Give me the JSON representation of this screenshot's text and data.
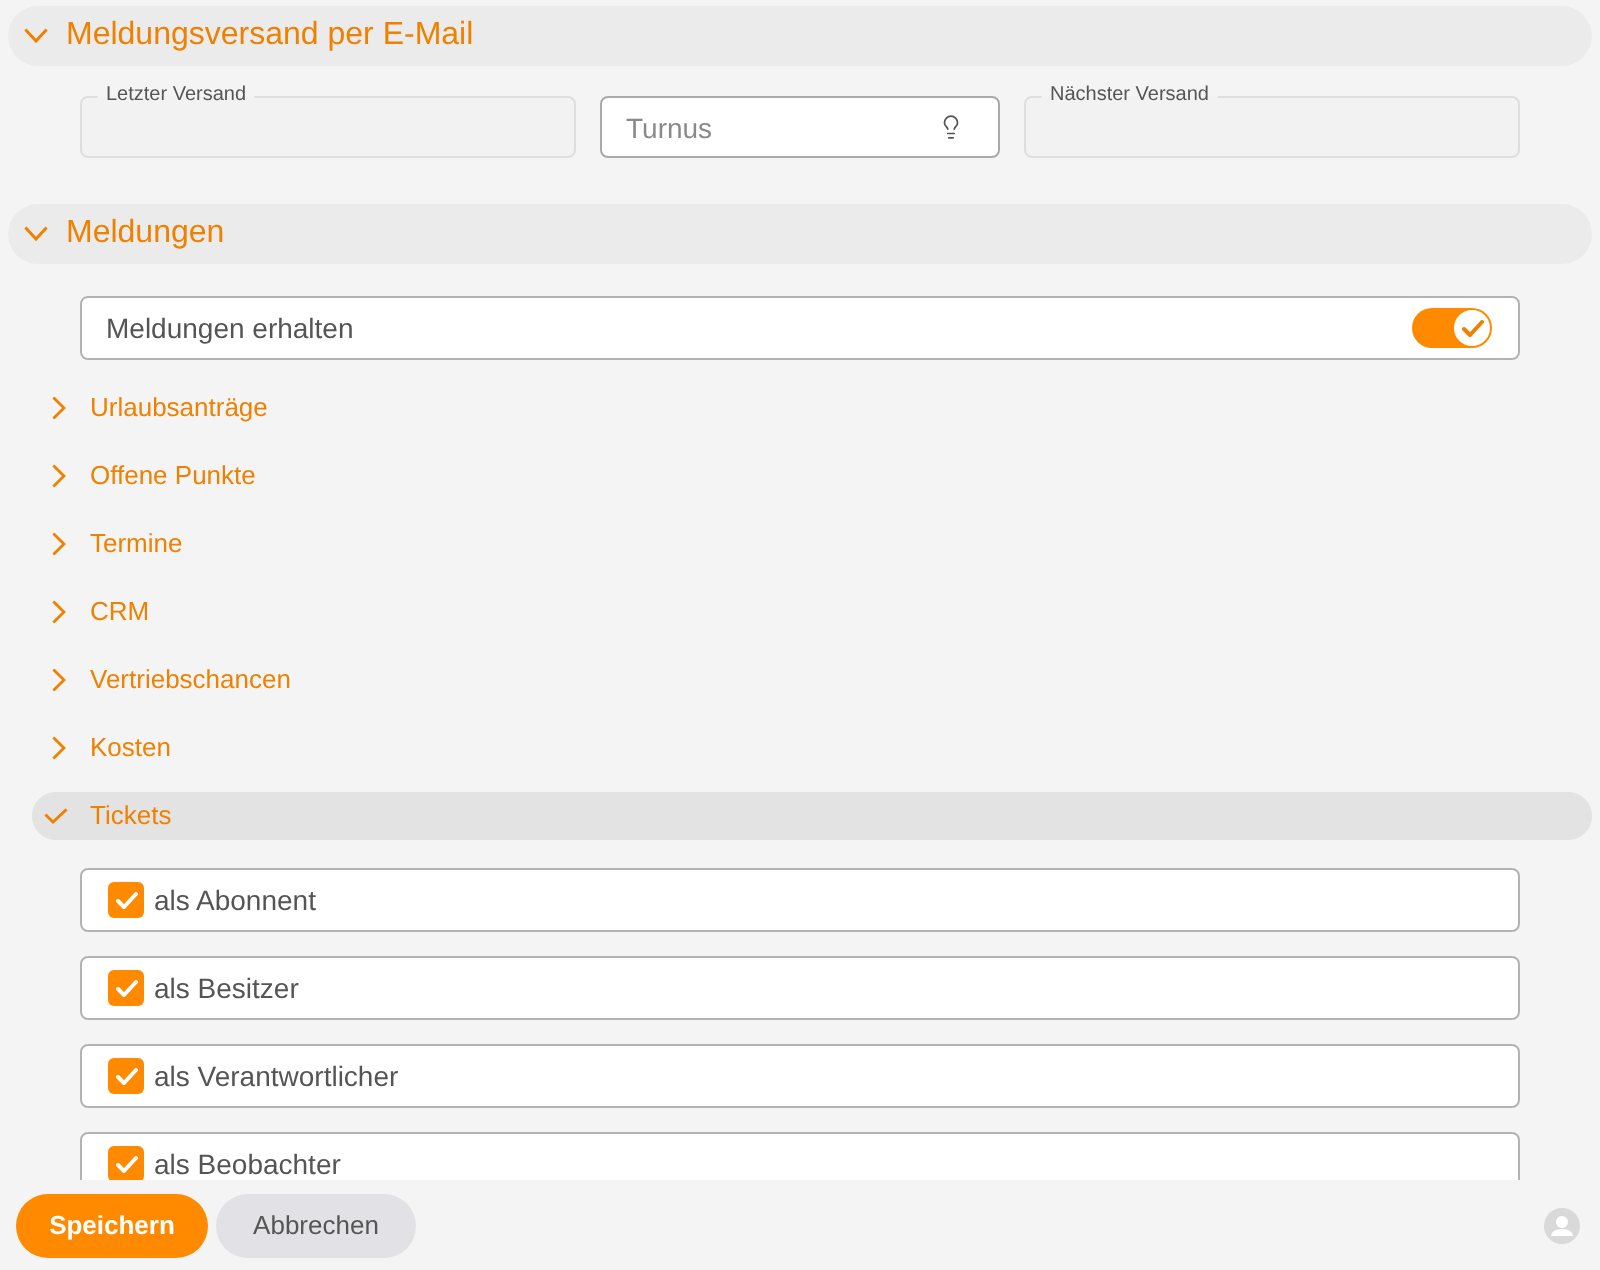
{
  "sections": [
    {
      "kind": "delivery",
      "title": "Meldungsversand per E-Mail",
      "expanded": true,
      "fields": [
        {
          "kind": "readonly",
          "label": "Letzter Versand"
        },
        {
          "kind": "input",
          "placeholder": "Turnus"
        },
        {
          "kind": "readonly",
          "label": "Nächster Versand"
        }
      ]
    },
    {
      "kind": "notifications",
      "title": "Meldungen",
      "expanded": true,
      "toggle": {
        "label": "Meldungen erhalten",
        "on": true
      },
      "categories": [
        {
          "label": "Urlaubsanträge",
          "expanded": false
        },
        {
          "label": "Offene Punkte",
          "expanded": false
        },
        {
          "label": "Termine",
          "expanded": false
        },
        {
          "label": "CRM",
          "expanded": false
        },
        {
          "label": "Vertriebschancen",
          "expanded": false
        },
        {
          "label": "Kosten",
          "expanded": false
        },
        {
          "label": "Tickets",
          "expanded": true,
          "options": [
            {
              "label": "als Abonnent",
              "checked": true
            },
            {
              "label": "als Besitzer",
              "checked": true
            },
            {
              "label": "als Verantwortlicher",
              "checked": true
            },
            {
              "label": "als Beobachter",
              "checked": true
            }
          ]
        }
      ]
    }
  ],
  "buttons": [
    {
      "kind": "primary",
      "label": "Speichern"
    },
    {
      "kind": "secondary",
      "label": "Abbrechen"
    }
  ]
}
